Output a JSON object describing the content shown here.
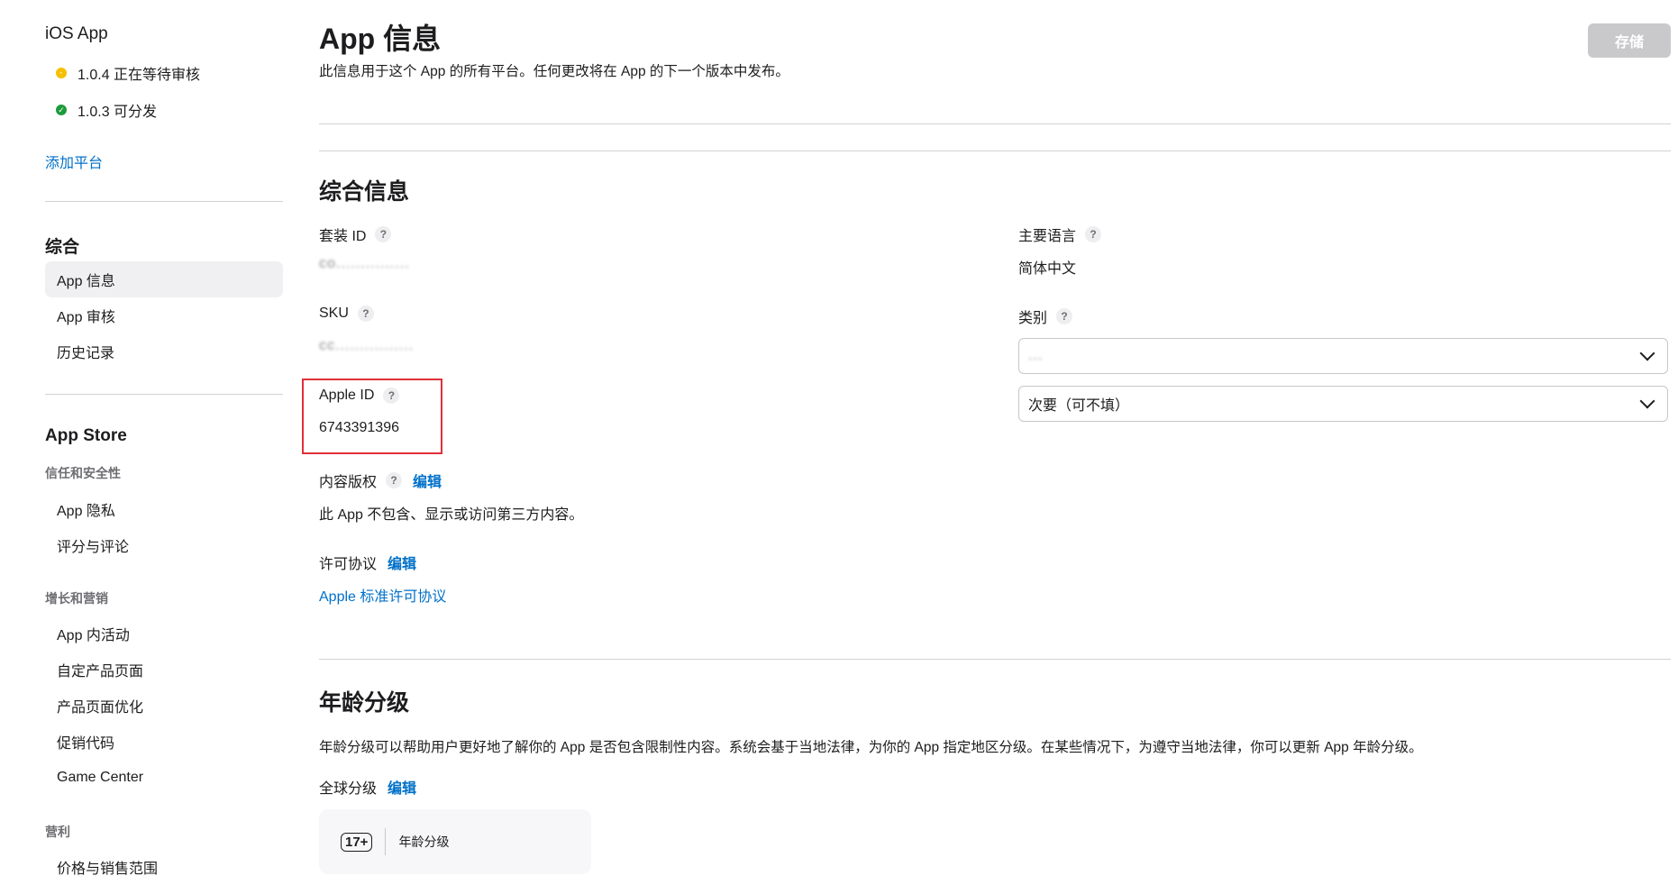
{
  "sidebar": {
    "platform": "iOS App",
    "versions": [
      {
        "label": "1.0.4 正在等待审核",
        "status_color": "#f5c000"
      },
      {
        "label": "1.0.3 可分发",
        "status_color": "#1d9b3b"
      }
    ],
    "add_platform": "添加平台",
    "general_title": "综合",
    "general_items": [
      "App 信息",
      "App 审核",
      "历史记录"
    ],
    "store_title": "App Store",
    "trust_title": "信任和安全性",
    "trust_items": [
      "App 隐私",
      "评分与评论"
    ],
    "growth_title": "增长和营销",
    "growth_items": [
      "App 内活动",
      "自定产品页面",
      "产品页面优化",
      "促销代码",
      "Game Center"
    ],
    "monetize_title": "营利",
    "monetize_items": [
      "价格与销售范围"
    ]
  },
  "header": {
    "title": "App 信息",
    "description": "此信息用于这个 App 的所有平台。任何更改将在 App 的下一个版本中发布。",
    "save_label": "存储"
  },
  "general": {
    "title": "综合信息",
    "bundle_id_label": "套装 ID",
    "bundle_id_value": "co...............",
    "sku_label": "SKU",
    "sku_value": "cc................",
    "apple_id_label": "Apple ID",
    "apple_id_value": "6743391396",
    "content_rights_label": "内容版权",
    "content_rights_edit": "编辑",
    "content_rights_value": "此 App 不包含、显示或访问第三方内容。",
    "license_label": "许可协议",
    "license_edit": "编辑",
    "license_value": "Apple 标准许可协议",
    "primary_language_label": "主要语言",
    "primary_language_value": "简体中文",
    "category_label": "类别",
    "category_primary": "...",
    "category_secondary": "次要（可不填）"
  },
  "age_rating": {
    "title": "年龄分级",
    "description": "年龄分级可以帮助用户更好地了解你的 App 是否包含限制性内容。系统会基于当地法律，为你的 App 指定地区分级。在某些情况下，为遵守当地法律，你可以更新 App 年龄分级。",
    "global_label": "全球分级",
    "global_edit": "编辑",
    "badge": "17+",
    "badge_label": "年龄分级"
  },
  "colors": {
    "accent": "#0070c9",
    "highlight": "#e0303a"
  },
  "icons": {
    "help": "question-mark-icon",
    "dropdown": "chevron-down-icon",
    "status_pending": "clock-icon",
    "status_ready": "checkmark-icon"
  }
}
